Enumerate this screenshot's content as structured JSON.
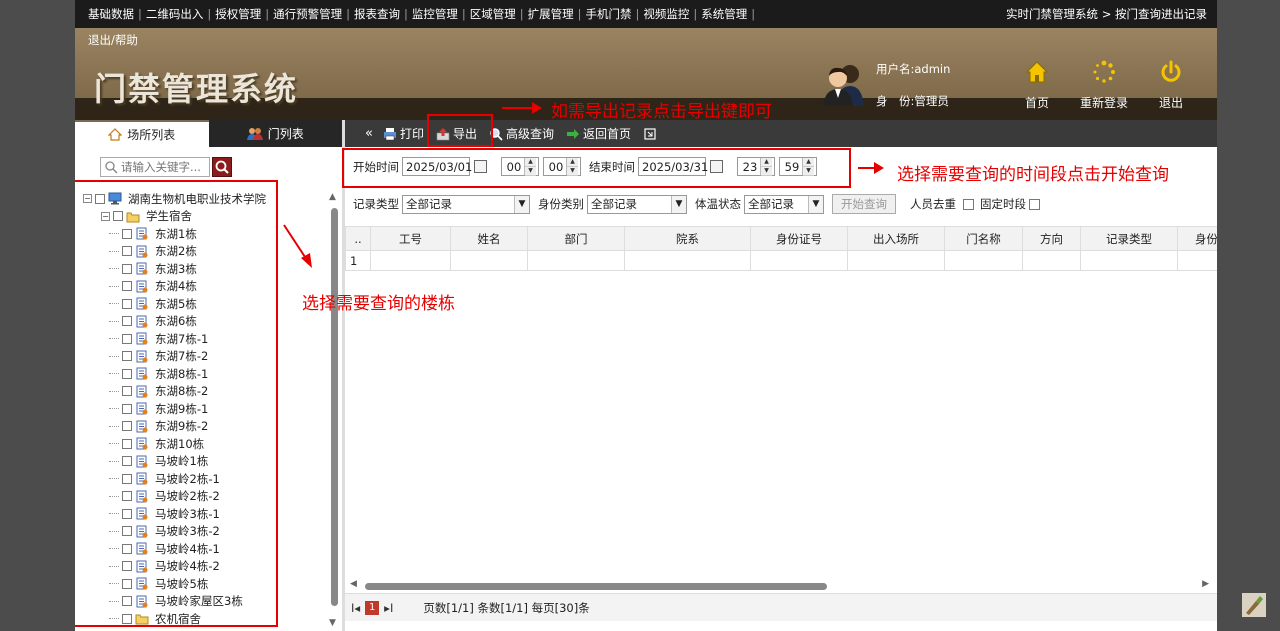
{
  "topnav": {
    "items": [
      "基础数据",
      "二维码出入",
      "授权管理",
      "通行预警管理",
      "报表查询",
      "监控管理",
      "区域管理",
      "扩展管理",
      "手机门禁",
      "视频监控",
      "系统管理"
    ],
    "breadcrumb": "实时门禁管理系统 > 按门查询进出记录"
  },
  "header": {
    "help": "退出/帮助",
    "title": "门禁管理系统",
    "username": "用户名:admin",
    "role": "身　份:管理员",
    "buttons": {
      "home": "首页",
      "relogin": "重新登录",
      "logout": "退出"
    }
  },
  "left": {
    "tabs": [
      "场所列表",
      "门列表"
    ],
    "search_placeholder": "请输入关键字...",
    "tree": {
      "root": "湖南生物机电职业技术学院",
      "group": "学生宿舍",
      "buildings": [
        "东湖1栋",
        "东湖2栋",
        "东湖3栋",
        "东湖4栋",
        "东湖5栋",
        "东湖6栋",
        "东湖7栋-1",
        "东湖7栋-2",
        "东湖8栋-1",
        "东湖8栋-2",
        "东湖9栋-1",
        "东湖9栋-2",
        "东湖10栋",
        "马坡岭1栋",
        "马坡岭2栋-1",
        "马坡岭2栋-2",
        "马坡岭3栋-1",
        "马坡岭3栋-2",
        "马坡岭4栋-1",
        "马坡岭4栋-2",
        "马坡岭5栋",
        "马坡岭家屋区3栋"
      ],
      "partial_last": "农机宿舍"
    }
  },
  "toolbar": {
    "collapse": "«",
    "print": "打印",
    "export": "导出",
    "advanced": "高级查询",
    "back": "返回首页"
  },
  "filters": {
    "start_label": "开始时间",
    "start_date": "2025/03/01",
    "start_hour": "00",
    "start_min": "00",
    "end_label": "结束时间",
    "end_date": "2025/03/31",
    "end_hour": "23",
    "end_min": "59",
    "record_type_label": "记录类型",
    "record_type": "全部记录",
    "identity_label": "身份类别",
    "identity": "全部记录",
    "temp_label": "体温状态",
    "temp": "全部记录",
    "query_btn": "开始查询",
    "dedupe_label": "人员去重",
    "fixed_label": "固定时段"
  },
  "grid": {
    "columns": [
      "..",
      "工号",
      "姓名",
      "部门",
      "院系",
      "身份证号",
      "出入场所",
      "门名称",
      "方向",
      "记录类型",
      "身份"
    ],
    "rows": [
      [
        "1",
        "",
        "",
        "",
        "",
        "",
        "",
        "",
        "",
        "",
        ""
      ]
    ]
  },
  "pager": {
    "first": "I◂",
    "page": "1",
    "last": "▸I",
    "info": "页数[1/1]  条数[1/1]  每页[30]条"
  },
  "annotations": {
    "export_tip": "如需导出记录点击导出键即可",
    "time_tip": "选择需要查询的时间段点击开始查询",
    "building_tip": "选择需要查询的楼栋"
  },
  "colors": {
    "accent": "#e60000",
    "header": "#8a7453",
    "nav": "#1b1b1b"
  }
}
